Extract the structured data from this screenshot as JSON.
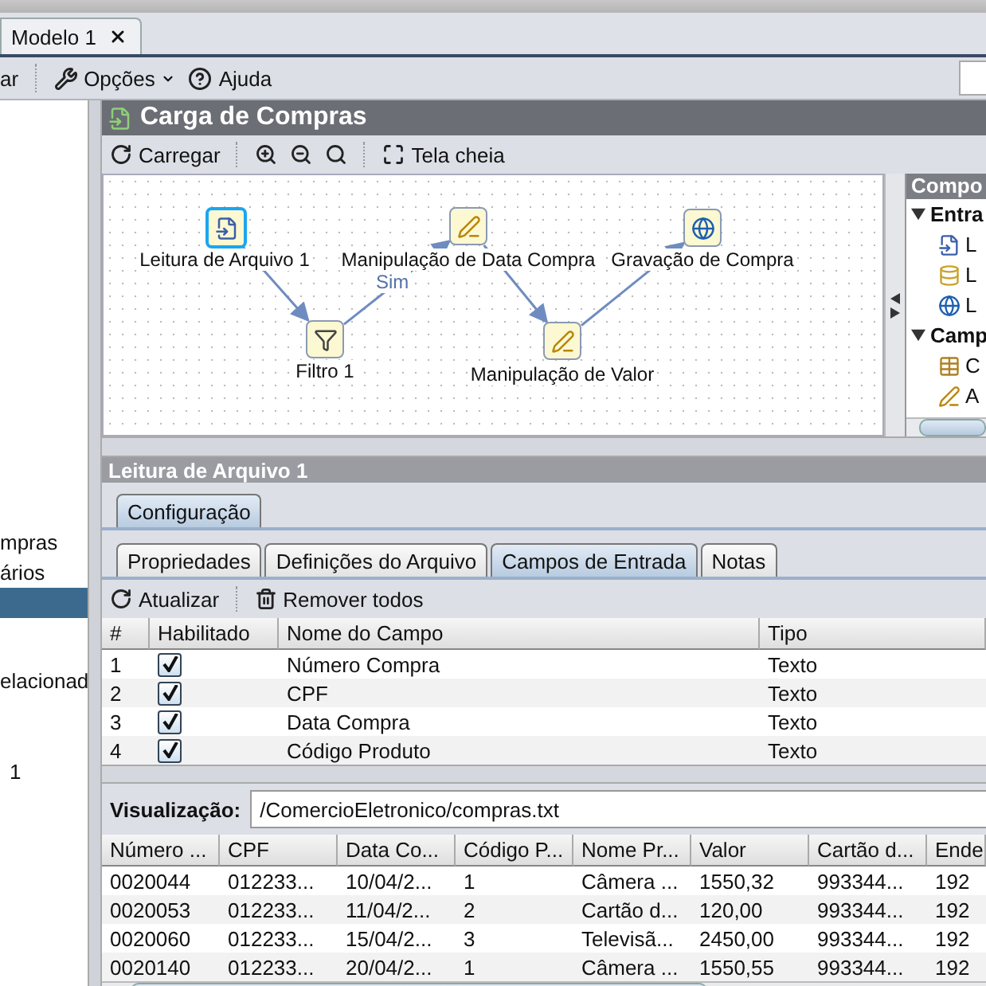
{
  "tabs": [
    {
      "label": "Modelo 1",
      "selected": true,
      "closable": true
    }
  ],
  "toolbar": {
    "items": [
      {
        "label": "ar",
        "kind": "text"
      },
      {
        "label": "Opções",
        "kind": "options"
      },
      {
        "label": "Ajuda",
        "kind": "help"
      }
    ]
  },
  "sidebar": {
    "items": [
      {
        "label": "mpras",
        "selected": false
      },
      {
        "label": "ários",
        "selected": false
      },
      {
        "selected": true
      },
      {
        "label": "elacionad",
        "selected": false
      },
      {
        "label": "1",
        "selected": false
      }
    ]
  },
  "flow": {
    "title": "Carga de Compras",
    "toolbar": [
      {
        "label": "Carregar",
        "kind": "reload"
      },
      {
        "kind": "zoom-in"
      },
      {
        "kind": "zoom-out"
      },
      {
        "kind": "zoom"
      },
      {
        "label": "Tela cheia",
        "kind": "fullscreen"
      }
    ],
    "nodes": [
      {
        "label": "Leitura de Arquivo 1",
        "kind": "reader",
        "selected": true
      },
      {
        "label": "Filtro 1",
        "kind": "filter",
        "selected": false
      },
      {
        "label": "Manipulação de Data Compra",
        "kind": "transform",
        "selected": false
      },
      {
        "label": "Manipulação de Valor",
        "kind": "transform",
        "selected": false
      },
      {
        "label": "Gravação de Compra",
        "kind": "writer",
        "selected": false
      }
    ],
    "edges": [
      {
        "kind": "plain"
      },
      {
        "kind": "labeled",
        "label": "Sim"
      },
      {
        "kind": "plain"
      },
      {
        "kind": "plain"
      }
    ],
    "palette": {
      "title": "Compo",
      "groups": [
        {
          "label": "Entra",
          "expanded": true,
          "children": [
            {
              "label": "L",
              "kind": "reader"
            },
            {
              "label": "L",
              "kind": "db"
            },
            {
              "label": "L",
              "kind": "web"
            }
          ]
        },
        {
          "label": "Camp",
          "expanded": true,
          "children": [
            {
              "label": "C",
              "kind": "table"
            },
            {
              "label": "A",
              "kind": "transform"
            }
          ]
        }
      ]
    }
  },
  "details": {
    "title": "Leitura de Arquivo 1",
    "tabs": [
      {
        "label": "Configuração",
        "selected": true
      }
    ],
    "subtabs": [
      {
        "label": "Propriedades",
        "selected": false
      },
      {
        "label": "Definições do Arquivo",
        "selected": false
      },
      {
        "label": "Campos de Entrada",
        "selected": true
      },
      {
        "label": "Notas",
        "selected": false
      }
    ],
    "actions": [
      {
        "label": "Atualizar",
        "kind": "reload"
      },
      {
        "label": "Remover todos",
        "kind": "trash"
      }
    ],
    "fields": {
      "columns": [
        "#",
        "Habilitado",
        "Nome do Campo",
        "Tipo"
      ],
      "rows": [
        {
          "index": "1",
          "checked": true,
          "name": "Número Compra",
          "type": "Texto"
        },
        {
          "index": "2",
          "checked": true,
          "name": "CPF",
          "type": "Texto"
        },
        {
          "index": "3",
          "checked": true,
          "name": "Data Compra",
          "type": "Texto"
        },
        {
          "index": "4",
          "checked": true,
          "name": "Código Produto",
          "type": "Texto"
        }
      ]
    },
    "preview": {
      "label": "Visualização:",
      "path": "/ComercioEletronico/compras.txt",
      "columns": [
        "Número ...",
        "CPF",
        "Data Co...",
        "Código P...",
        "Nome Pr...",
        "Valor",
        "Cartão d...",
        "Ende"
      ],
      "rows": [
        [
          "0020044",
          "012233...",
          "10/04/2...",
          "1",
          "Câmera ...",
          "1550,32",
          "993344...",
          "192"
        ],
        [
          "0020053",
          "012233...",
          "11/04/2...",
          "2",
          "Cartão d...",
          "120,00",
          "993344...",
          "192"
        ],
        [
          "0020060",
          "012233...",
          "15/04/2...",
          "3",
          "Televisã...",
          "2450,00",
          "993344...",
          "192"
        ],
        [
          "0020140",
          "012233...",
          "20/04/2...",
          "1",
          "Câmera ...",
          "1550,55",
          "993344...",
          "192"
        ]
      ]
    }
  }
}
